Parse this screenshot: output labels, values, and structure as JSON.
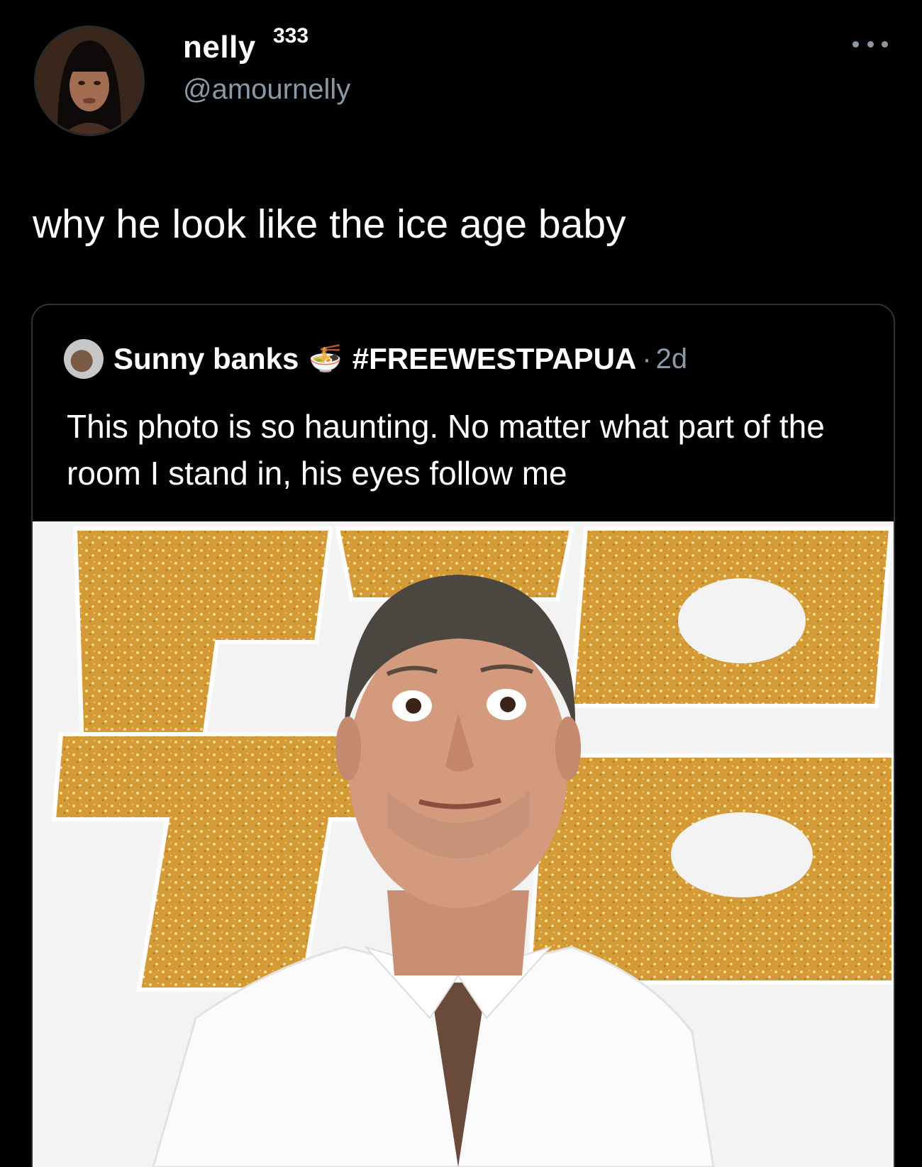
{
  "tweet": {
    "display_name": "nelly",
    "name_badge": "333",
    "handle": "@amournelly",
    "text": "why he look like the ice age baby",
    "avatar_icon": "user-avatar",
    "more_icon": "more-options-icon"
  },
  "quoted_tweet": {
    "display_name": "Sunny banks",
    "emoji": "🍜",
    "hashtag": "#FREEWESTPAPUA",
    "separator": "·",
    "time": "2d",
    "text": "This photo is so haunting. No matter what part of the room I stand in, his eyes follow me",
    "photo_icon": "tweet-photo"
  },
  "colors": {
    "background": "#000000",
    "primary_text": "#ffffff",
    "secondary_text": "#8b98a5",
    "card_border": "#2f3336",
    "glitter_gold": "#d9a441"
  }
}
